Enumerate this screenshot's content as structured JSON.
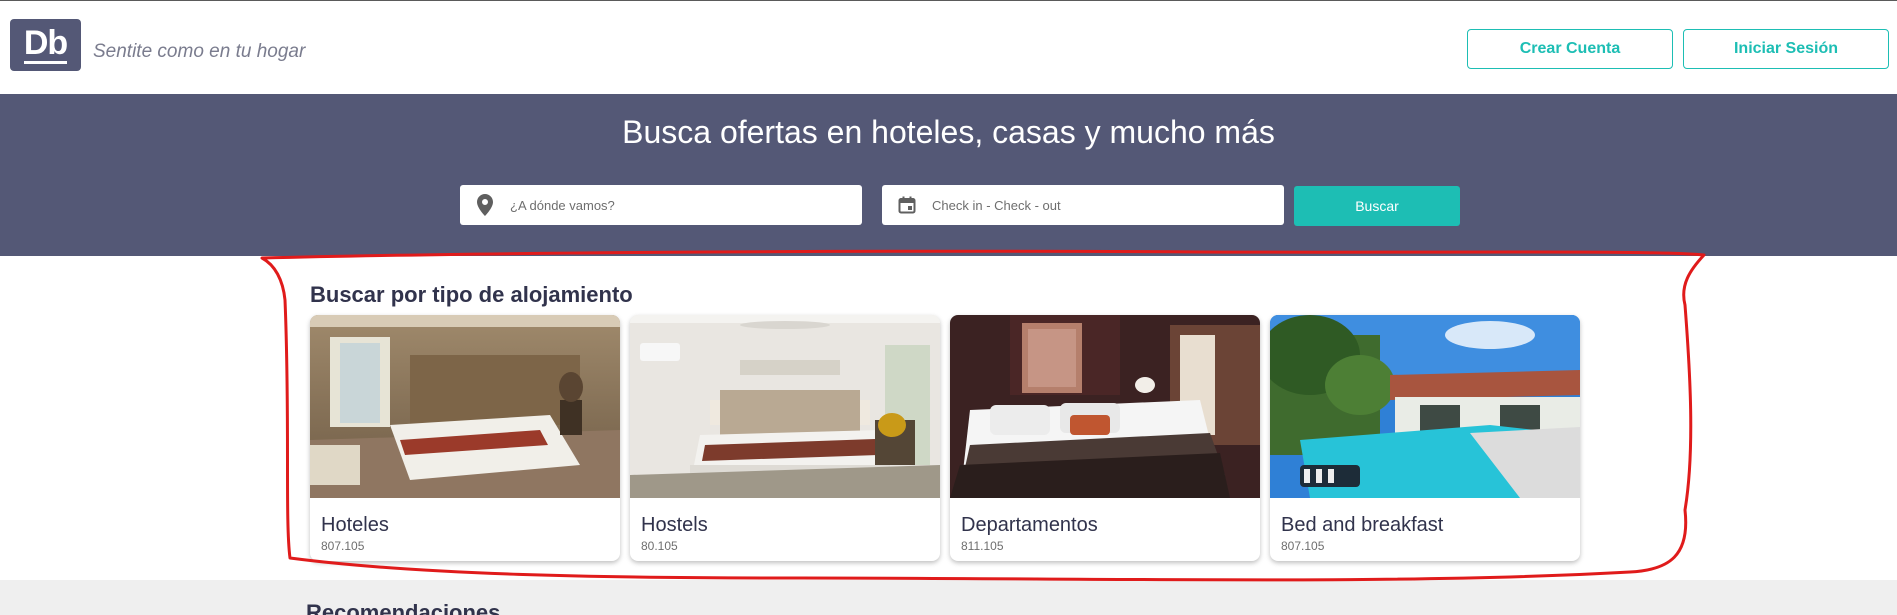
{
  "header": {
    "logo_text": "Db",
    "tagline": "Sentite como en tu hogar",
    "create_account_label": "Crear Cuenta",
    "login_label": "Iniciar Sesión"
  },
  "hero": {
    "title": "Busca ofertas en hoteles, casas y mucho más",
    "destination_placeholder": "¿A dónde vamos?",
    "dates_placeholder": "Check in - Check - out",
    "search_label": "Buscar",
    "location_icon": "location-pin-icon",
    "calendar_icon": "calendar-icon"
  },
  "categories": {
    "title": "Buscar por tipo de alojamiento",
    "items": [
      {
        "label": "Hoteles",
        "count": "807.105"
      },
      {
        "label": "Hostels",
        "count": "80.105"
      },
      {
        "label": "Departamentos",
        "count": "811.105"
      },
      {
        "label": "Bed and breakfast",
        "count": "807.105"
      }
    ]
  },
  "recommendations": {
    "title": "Recomendaciones"
  },
  "colors": {
    "brand": "#545876",
    "accent": "#1dbeb4",
    "annotation": "#e01b1b"
  }
}
